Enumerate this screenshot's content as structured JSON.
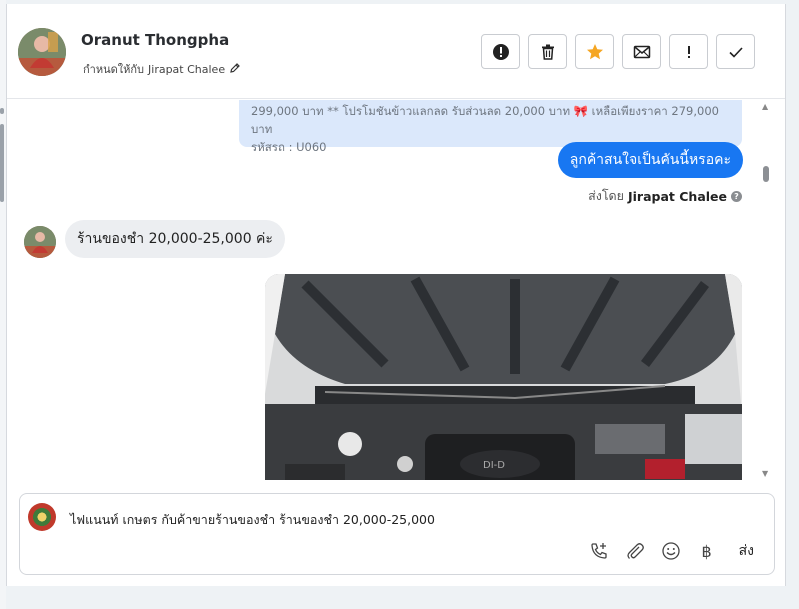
{
  "header": {
    "contact_name": "Oranut Thongpha",
    "assigned_prefix": "กำหนดให้กับ",
    "assigned_to": "Jirapat Chalee"
  },
  "toolbar": {
    "buttons": [
      {
        "name": "report-button",
        "icon": "alert-circle-icon"
      },
      {
        "name": "delete-button",
        "icon": "trash-icon"
      },
      {
        "name": "star-button",
        "icon": "star-icon",
        "color": "#f5a623"
      },
      {
        "name": "mail-button",
        "icon": "envelope-icon"
      },
      {
        "name": "important-button",
        "icon": "exclamation-icon"
      },
      {
        "name": "done-button",
        "icon": "check-icon"
      }
    ]
  },
  "chat": {
    "quoted_line_1": "299,000 บาท ** โปรโมชันข้าวแลกลด รับส่วนลด 20,000 บาท 🎀 เหลือเพียงราคา 279,000 บาท",
    "quoted_line_2": "รหัสรถ : U060",
    "sent_message": "ลูกค้าสนใจเป็นคันนี้หรอคะ",
    "sent_by_label": "ส่งโดย",
    "sent_by_name": "Jirapat Chalee",
    "received_message": "ร้านของชำ 20,000-25,000 ค่ะ",
    "photo_icon": "car-engine-photo"
  },
  "composer": {
    "text": "ไฟแนนท์ เกษตร กับค้าขายร้านของชำ ร้านของชำ 20,000-25,000",
    "baht_symbol": "฿",
    "send_label": "ส่ง"
  },
  "colors": {
    "accent": "#1877f2",
    "quote_bg": "#dbe8fb",
    "star": "#f5a623"
  }
}
